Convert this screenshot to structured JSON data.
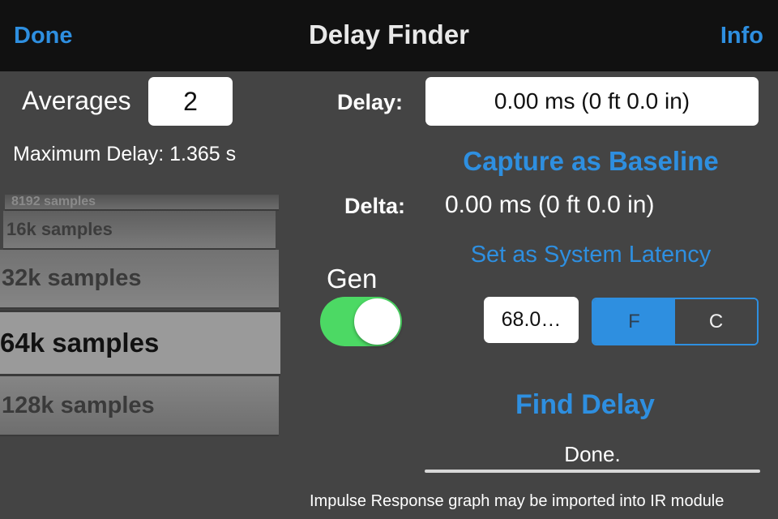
{
  "nav": {
    "done_label": "Done",
    "title": "Delay Finder",
    "info_label": "Info"
  },
  "averages": {
    "label": "Averages",
    "value": "2"
  },
  "max_delay_text": "Maximum Delay: 1.365 s",
  "delay": {
    "label": "Delay:",
    "value": "0.00 ms (0 ft 0.0 in)"
  },
  "capture_baseline_label": "Capture as Baseline",
  "delta": {
    "label": "Delta:",
    "value": "0.00 ms (0 ft 0.0 in)"
  },
  "set_latency_label": "Set as System Latency",
  "picker": {
    "items": [
      "8192 samples",
      "16k samples",
      "32k samples",
      "64k samples",
      "128k samples"
    ],
    "selected": "64k samples"
  },
  "gen": {
    "label": "Gen",
    "on": true
  },
  "temperature": {
    "value": "68.0…",
    "units": [
      "F",
      "C"
    ],
    "selected_unit": "F"
  },
  "find_delay_label": "Find Delay",
  "status_text": "Done.",
  "footer_text": "Impulse Response graph may be imported into IR module",
  "colors": {
    "accent": "#2e8fe0",
    "toggle_on": "#4cd964",
    "background": "#444444",
    "navbar": "#111111"
  }
}
